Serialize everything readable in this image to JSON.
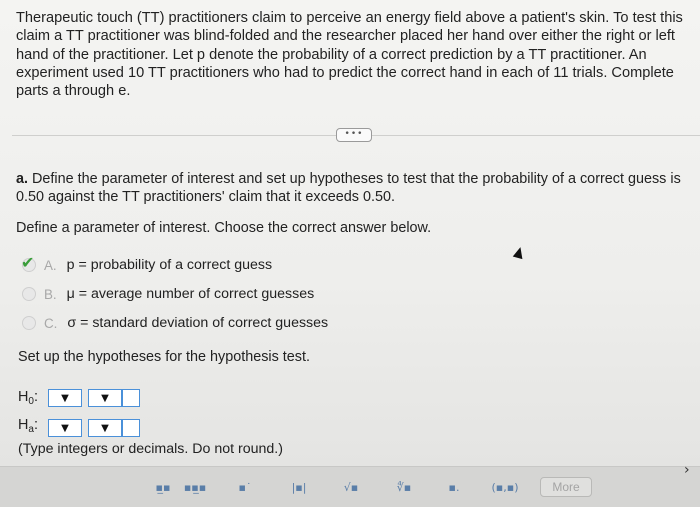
{
  "problem": {
    "intro": "Therapeutic touch (TT) practitioners claim to perceive an energy field above a patient's skin. To test this claim a TT practitioner was blind-folded and the researcher placed her hand over either the right or left hand of the practitioner. Let p denote the probability of a correct prediction by a TT practitioner. An experiment used 10 TT practitioners who had to predict the correct hand in each of 11 trials. Complete parts a through e.",
    "more_pill": "•••"
  },
  "part_a": {
    "label": "a.",
    "question": "Define the parameter of interest and set up hypotheses to test that the probability of a correct guess is 0.50 against the TT practitioners' claim that it exceeds 0.50.",
    "instruction": "Define a parameter of interest. Choose the correct answer below.",
    "choices": [
      {
        "letter": "A.",
        "text": "p = probability of a correct guess",
        "selected": true
      },
      {
        "letter": "B.",
        "text": "μ = average number of correct guesses",
        "selected": false
      },
      {
        "letter": "C.",
        "text": "σ = standard deviation of correct guesses",
        "selected": false
      }
    ],
    "setup": "Set up the hypotheses for the hypothesis test.",
    "h0_label": "H",
    "h0_sub": "0",
    "ha_label": "H",
    "ha_sub": "a",
    "colon": ":",
    "dropdown_arrow": "▼",
    "type_note": "(Type integers or decimals. Do not round.)"
  },
  "toolbar": {
    "tools": [
      {
        "name": "fraction-tool",
        "glyph": "▪̲▪"
      },
      {
        "name": "mixed-number-tool",
        "glyph": "▪▪̲▪"
      },
      {
        "name": "exponent-tool",
        "glyph": "▪˙"
      },
      {
        "name": "absolute-value-tool",
        "glyph": "|▪|"
      },
      {
        "name": "square-root-tool",
        "glyph": "√▪"
      },
      {
        "name": "nth-root-tool",
        "glyph": "∜▪"
      },
      {
        "name": "decimal-tool",
        "glyph": "▪."
      },
      {
        "name": "interval-tool",
        "glyph": "(▪,▪)"
      }
    ],
    "more_label": "More"
  },
  "colors": {
    "accent": "#4a90d9",
    "check": "#3a9d3a",
    "toolbar_bg": "#d5d5d3"
  }
}
